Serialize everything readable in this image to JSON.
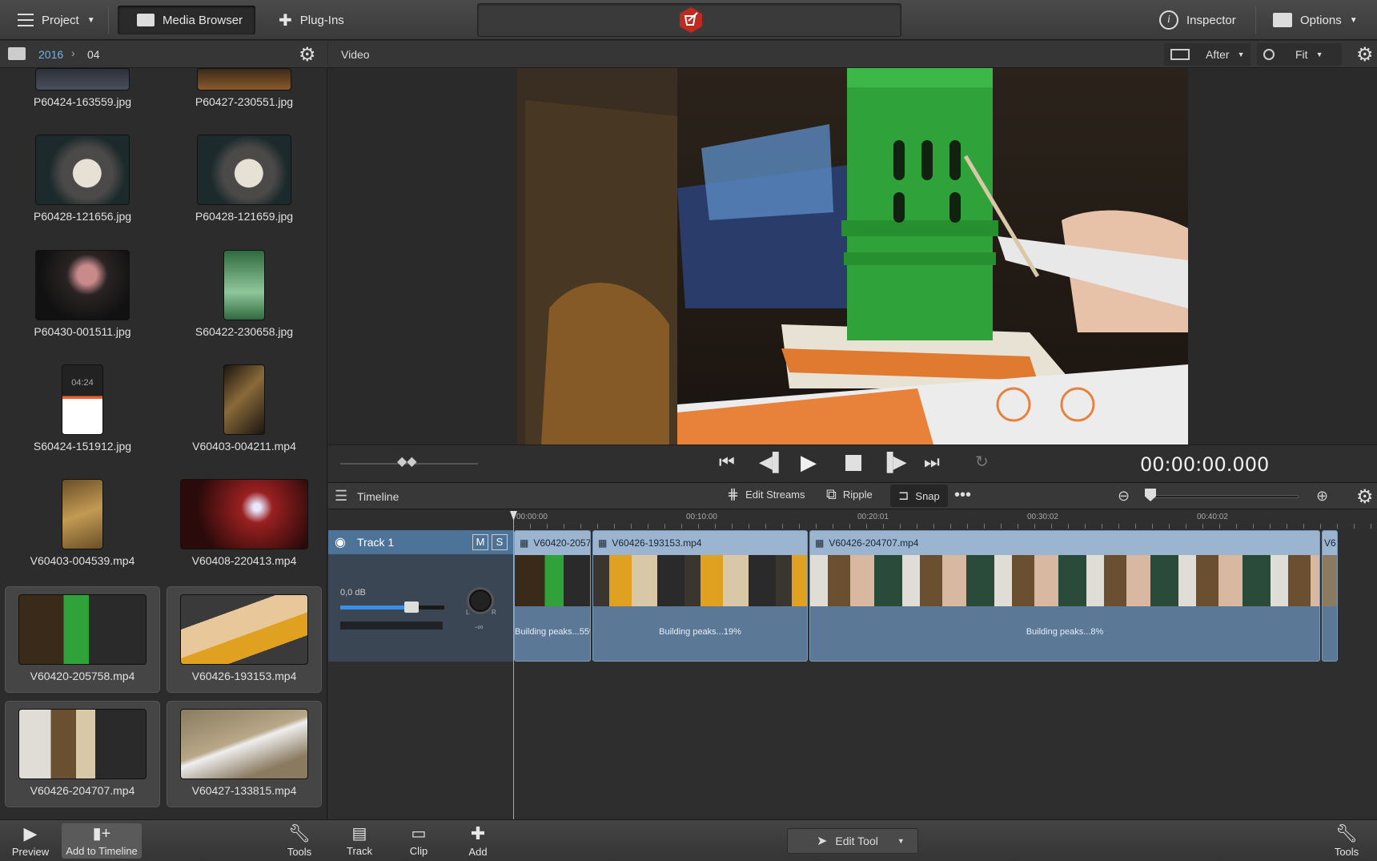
{
  "topbar": {
    "project": "Project",
    "media_browser": "Media Browser",
    "plugins": "Plug-Ins",
    "inspector": "Inspector",
    "options": "Options"
  },
  "browser": {
    "crumb_year": "2016",
    "crumb_month": "04",
    "items": [
      {
        "name": "P60424-163559.jpg"
      },
      {
        "name": "P60427-230551.jpg"
      },
      {
        "name": "P60428-121656.jpg"
      },
      {
        "name": "P60428-121659.jpg"
      },
      {
        "name": "P60430-001511.jpg"
      },
      {
        "name": "S60422-230658.jpg"
      },
      {
        "name": "S60424-151912.jpg"
      },
      {
        "name": "V60403-004211.mp4"
      },
      {
        "name": "V60403-004539.mp4"
      },
      {
        "name": "V60408-220413.mp4"
      },
      {
        "name": "V60420-205758.mp4"
      },
      {
        "name": "V60426-193153.mp4"
      },
      {
        "name": "V60426-204707.mp4"
      },
      {
        "name": "V60427-133815.mp4"
      }
    ],
    "phone_time": "04:24"
  },
  "viewer": {
    "title": "Video",
    "mode": "After",
    "zoom": "Fit",
    "timecode": "00:00:00.000"
  },
  "timeline": {
    "title": "Timeline",
    "edit_streams": "Edit Streams",
    "ripple": "Ripple",
    "snap": "Snap",
    "ruler": [
      "00:00:00",
      "00:10:00",
      "00:20:01",
      "00:30:02",
      "00:40:02"
    ],
    "track": {
      "name": "Track 1",
      "mute": "M",
      "solo": "S",
      "volume": "0,0 dB",
      "pan_l": "L",
      "pan_r": "R",
      "pan_val": "-∞"
    },
    "clips": [
      {
        "name": "V60420-2057",
        "label": "Building peaks...55%"
      },
      {
        "name": "V60426-193153.mp4",
        "label": "Building peaks...19%"
      },
      {
        "name": "V60426-204707.mp4",
        "label": "Building peaks...8%"
      },
      {
        "name": "V6",
        "label": ""
      }
    ]
  },
  "bottom": {
    "preview": "Preview",
    "add_to_timeline": "Add to Timeline",
    "tools_left": "Tools",
    "track": "Track",
    "clip": "Clip",
    "add": "Add",
    "edit_tool": "Edit Tool",
    "tools_right": "Tools"
  },
  "colors": {
    "accent": "#4d7398",
    "clip_head": "#9bb4cf",
    "logo": "#c0291f"
  }
}
